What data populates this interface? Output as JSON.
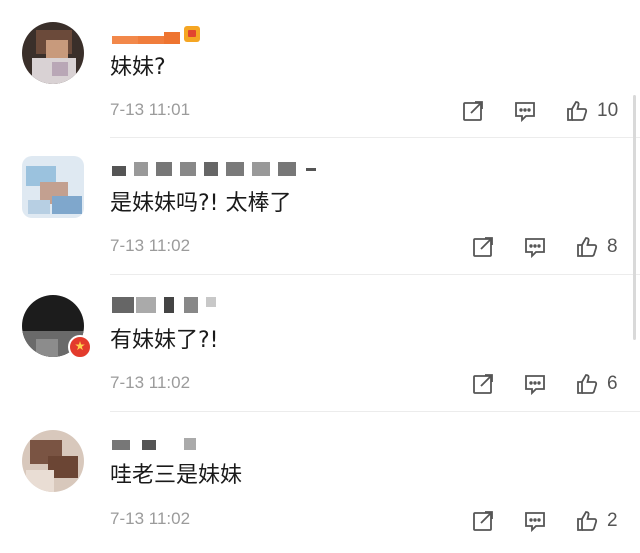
{
  "comments": [
    {
      "text": "妹妹?",
      "time": "7-13 11:01",
      "likes": "10",
      "has_vip_badge": true
    },
    {
      "text": "是妹妹吗?! 太棒了",
      "time": "7-13 11:02",
      "likes": "8",
      "has_vip_badge": false
    },
    {
      "text": "有妹妹了?!",
      "time": "7-13 11:02",
      "likes": "6",
      "has_vip_badge": false
    },
    {
      "text": "哇老三是妹妹",
      "time": "7-13 11:02",
      "likes": "2",
      "has_vip_badge": false
    }
  ],
  "icons": {
    "share": "share-icon",
    "reply": "reply-icon",
    "like": "thumbs-up-icon"
  },
  "colors": {
    "text": "#1a1a1a",
    "meta": "#9b9b9b",
    "icon": "#555555",
    "divider": "#ececec"
  }
}
